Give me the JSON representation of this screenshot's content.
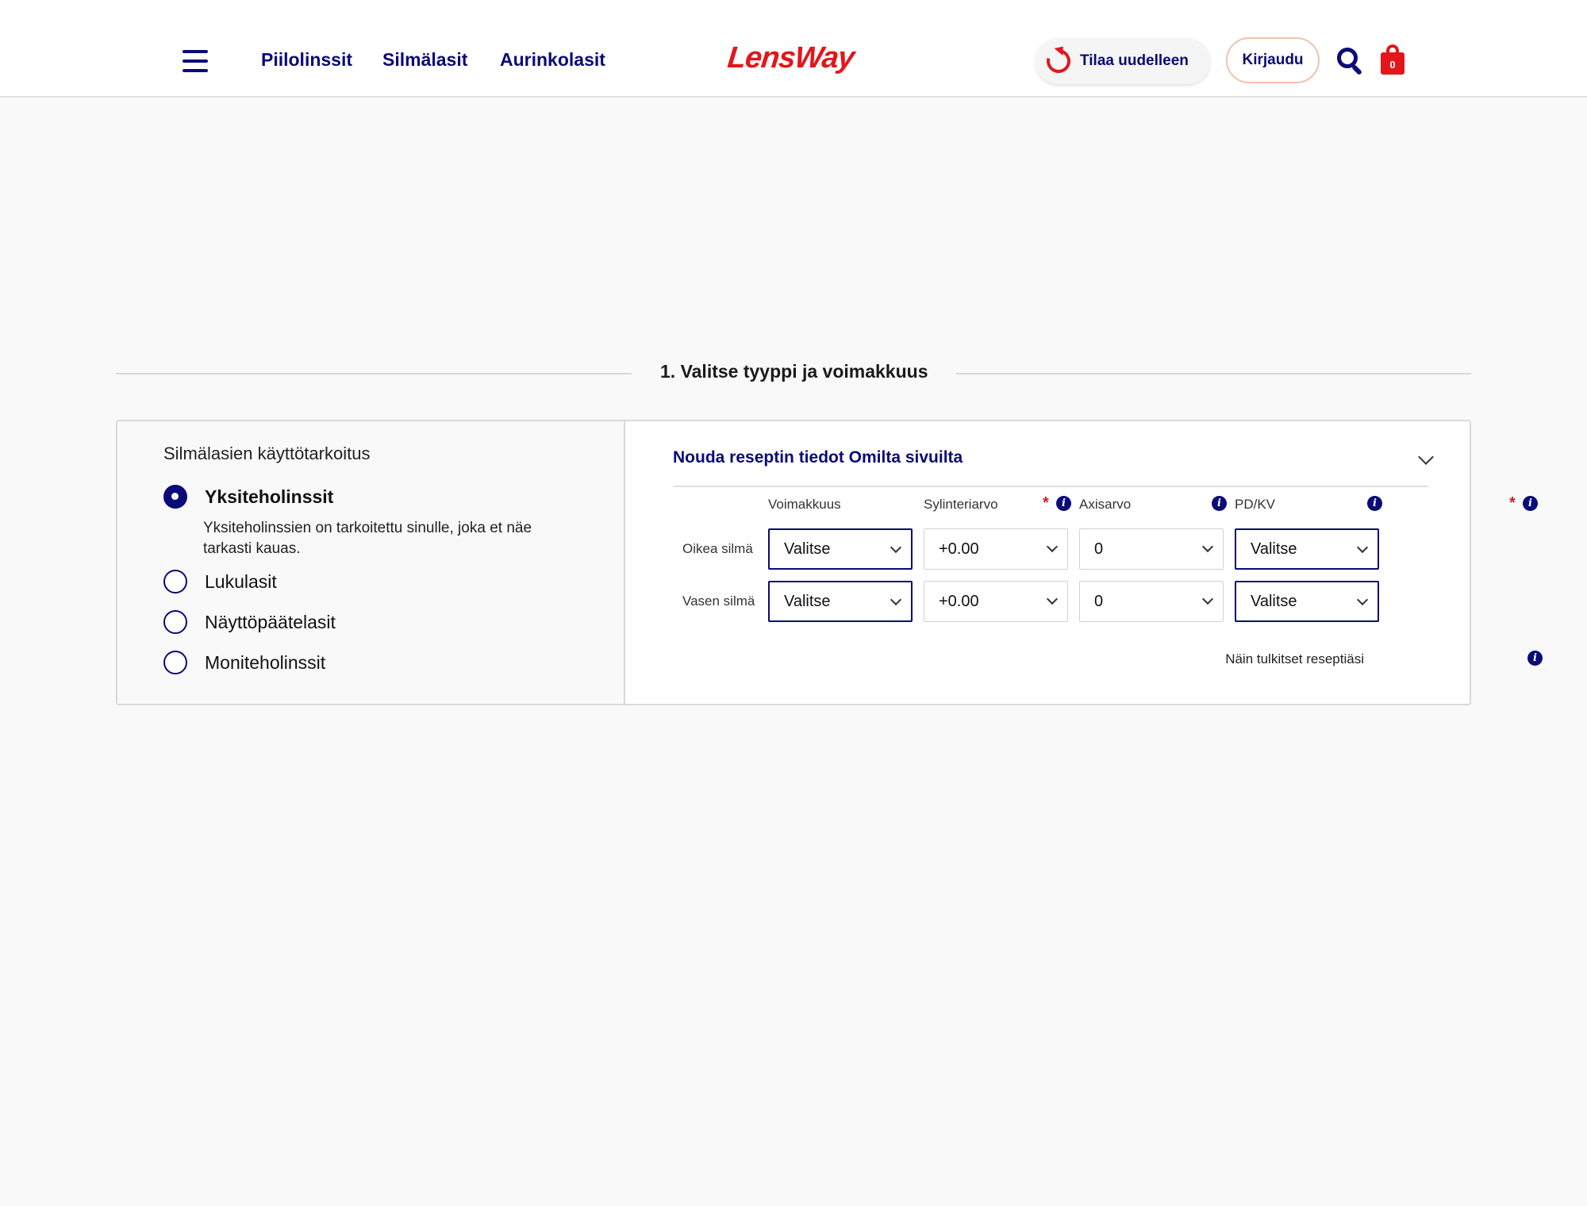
{
  "header": {
    "nav": [
      "Piilolinssit",
      "Silmälasit",
      "Aurinkolasit"
    ],
    "logo": "LensWay",
    "reorder_label": "Tilaa uudelleen",
    "login_label": "Kirjaudu",
    "cart_count": "0",
    "colors": {
      "brand_red": "#e3161b",
      "navy": "#0a0a78"
    }
  },
  "section": {
    "title": "1.  Valitse tyyppi ja voimakkuus"
  },
  "purpose": {
    "title": "Silmälasien käyttötarkoitus",
    "options": [
      {
        "label": "Yksiteholinssit",
        "selected": true
      },
      {
        "label": "Lukulasit",
        "selected": false
      },
      {
        "label": "Näyttöpäätelasit",
        "selected": false
      },
      {
        "label": "Moniteholinssit",
        "selected": false
      }
    ],
    "description": "Yksiteholinssien on tarkoitettu sinulle, joka et näe tarkasti kauas."
  },
  "prescription": {
    "fetch_link": "Nouda reseptin tiedot Omilta sivuilta",
    "columns": [
      {
        "label": "Voimakkuus",
        "required": true
      },
      {
        "label": "Sylinteriarvo",
        "required": false
      },
      {
        "label": "Axisarvo",
        "required": false
      },
      {
        "label": "PD/KV",
        "required": true
      }
    ],
    "required_mark": "*",
    "info_glyph": "i",
    "rows": [
      {
        "label": "Oikea silmä",
        "values": [
          "Valitse",
          "+0.00",
          "0",
          "Valitse"
        ]
      },
      {
        "label": "Vasen silmä",
        "values": [
          "Valitse",
          "+0.00",
          "0",
          "Valitse"
        ]
      }
    ],
    "help_link": "Näin tulkitset reseptiäsi"
  }
}
